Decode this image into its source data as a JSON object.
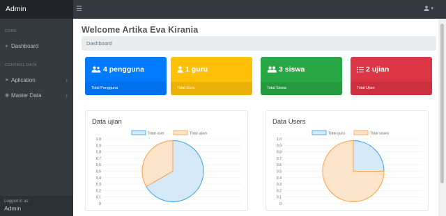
{
  "navbar": {
    "brand": "Admin",
    "toggle_icon": "hamburger-icon",
    "user_icon": "user-icon"
  },
  "sidebar": {
    "sections": [
      {
        "heading": "CORE",
        "items": [
          {
            "label": "Dashboard",
            "icon": "dashboard-icon"
          }
        ]
      },
      {
        "heading": "CONTROL DATA",
        "items": [
          {
            "label": "Aplication",
            "icon": "paper-plane-icon",
            "chevron": "›"
          },
          {
            "label": "Master Data",
            "icon": "database-icon",
            "chevron": "›"
          }
        ]
      }
    ],
    "footer": {
      "caption": "Logged in as:",
      "user": "Admin"
    }
  },
  "main": {
    "title": "Welcome Artika Eva Kirania",
    "breadcrumb": "Dashboard",
    "cards": [
      {
        "value": "4 pengguna",
        "footer": "Total Pengguna",
        "color": "#007bff",
        "icon": "users-icon"
      },
      {
        "value": "1 guru",
        "footer": "Total Guru",
        "color": "#ffc107",
        "icon": "teacher-icon"
      },
      {
        "value": "3 siswa",
        "footer": "Total Siswa",
        "color": "#28a745",
        "icon": "students-icon"
      },
      {
        "value": "2 ujian",
        "footer": "Total Ujian",
        "color": "#dc3545",
        "icon": "list-icon"
      }
    ]
  },
  "chart_data": [
    {
      "type": "pie",
      "title": "Data ujian",
      "labels": [
        "Total user",
        "Total ujian"
      ],
      "values": [
        4,
        2
      ],
      "colors": {
        "fill": [
          "#d6e9f8",
          "#fde5cc"
        ],
        "stroke": [
          "#36a2eb",
          "#ff9f40"
        ]
      },
      "ytick_labels": [
        "1.0",
        "0.9",
        "0.8",
        "0.7",
        "0.6",
        "0.5",
        "0.4",
        "0.3",
        "0.2",
        "0.1",
        "0"
      ],
      "legend": "top"
    },
    {
      "type": "pie",
      "title": "Data Users",
      "labels": [
        "Total guru",
        "Total siswa"
      ],
      "values": [
        1,
        3
      ],
      "colors": {
        "fill": [
          "#d6e9f8",
          "#fde5cc"
        ],
        "stroke": [
          "#36a2eb",
          "#ff9f40"
        ]
      },
      "ytick_labels": [
        "1.0",
        "0.9",
        "0.8",
        "0.7",
        "0.6",
        "0.5",
        "0.4",
        "0.3",
        "0.2",
        "0.1",
        "0"
      ],
      "legend": "top"
    }
  ]
}
